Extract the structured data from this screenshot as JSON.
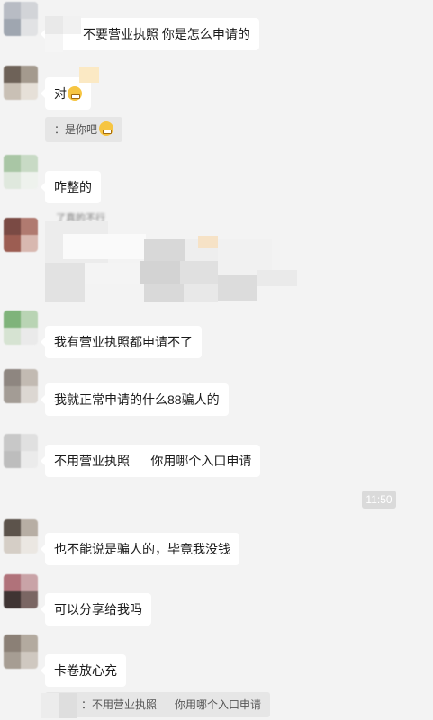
{
  "messages": [
    {
      "text": "不要营业执照  你是怎么申请的"
    },
    {
      "text": "对"
    },
    {
      "quote": "：是你吧"
    },
    {
      "text": "咋整的"
    },
    {
      "sender": "了真的不行"
    },
    {
      "text": "我有营业执照都申请不了"
    },
    {
      "text": "我就正常申请的什么88骗人的"
    },
    {
      "text": "不用营业执照      你用哪个入口申请"
    },
    {
      "text": "也不能说是骗人的，毕竟我没钱"
    },
    {
      "text": "可以分享给我吗"
    },
    {
      "text": "卡卷放心充"
    },
    {
      "quote": "：不用营业执照      你用哪个入口申请"
    }
  ],
  "timestamp": "11:50",
  "emojis": [
    "grimace-emoji",
    "dizzy-emoji"
  ]
}
